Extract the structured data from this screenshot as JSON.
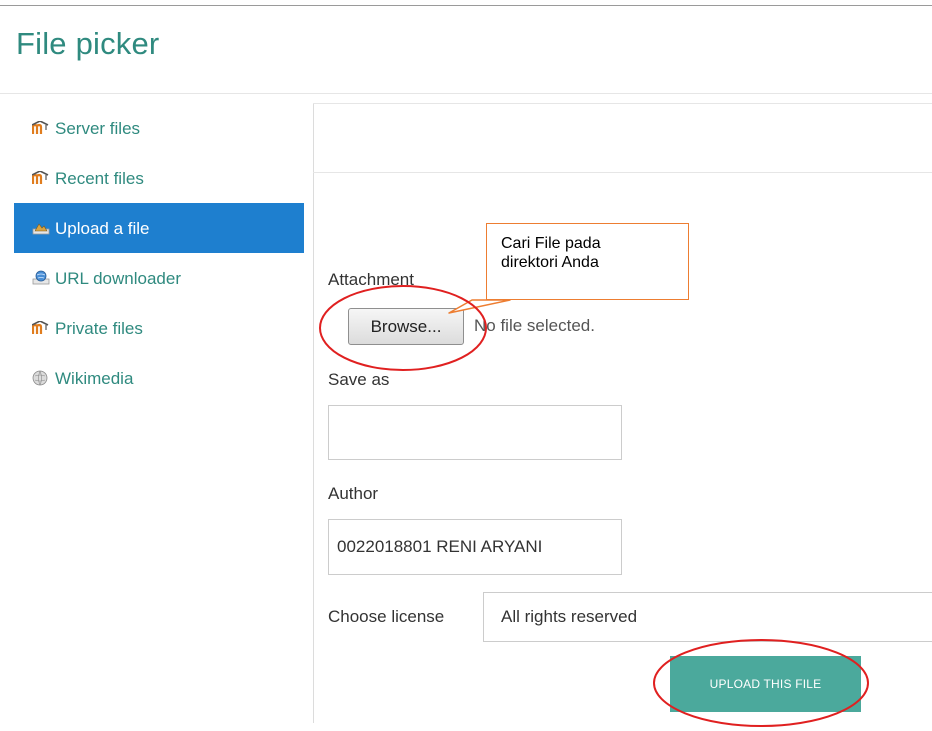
{
  "header": {
    "title": "File picker"
  },
  "sidebar": {
    "items": [
      {
        "label": "Server files",
        "icon": "moodle-icon"
      },
      {
        "label": "Recent files",
        "icon": "moodle-icon"
      },
      {
        "label": "Upload a file",
        "icon": "upload-icon",
        "active": true
      },
      {
        "label": "URL downloader",
        "icon": "url-downloader-icon"
      },
      {
        "label": "Private files",
        "icon": "moodle-icon"
      },
      {
        "label": "Wikimedia",
        "icon": "wikimedia-icon"
      }
    ]
  },
  "form": {
    "attachment_label": "Attachment",
    "browse_label": "Browse...",
    "file_status": "No file selected.",
    "saveas_label": "Save as",
    "saveas_value": "",
    "author_label": "Author",
    "author_value": "0022018801 RENI ARYANI",
    "license_label": "Choose license",
    "license_value": "All rights reserved",
    "upload_label": "UPLOAD THIS FILE"
  },
  "annotation": {
    "callout_text": "Cari File pada\ndirektori Anda"
  },
  "colors": {
    "accent": "#2f8a7f",
    "active_nav": "#1e7fcf",
    "upload_button": "#4ba99c",
    "highlight": "#e02020",
    "callout_border": "#ed7d31"
  }
}
